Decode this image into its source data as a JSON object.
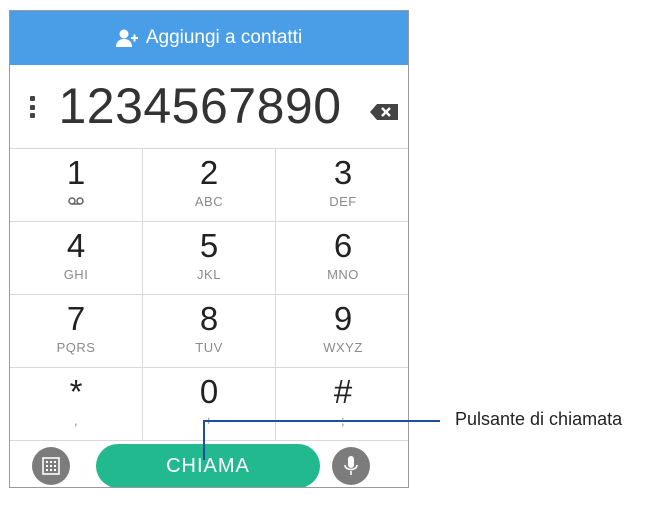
{
  "header": {
    "add_contact_label": "Aggiungi a contatti",
    "add_contact_icon": "add-contact-icon"
  },
  "display": {
    "number": "1234567890",
    "menu_icon": "overflow-menu-icon",
    "backspace_icon": "backspace-icon"
  },
  "keypad": {
    "keys": [
      {
        "digit": "1",
        "sub": ""
      },
      {
        "digit": "2",
        "sub": "ABC"
      },
      {
        "digit": "3",
        "sub": "DEF"
      },
      {
        "digit": "4",
        "sub": "GHI"
      },
      {
        "digit": "5",
        "sub": "JKL"
      },
      {
        "digit": "6",
        "sub": "MNO"
      },
      {
        "digit": "7",
        "sub": "PQRS"
      },
      {
        "digit": "8",
        "sub": "TUV"
      },
      {
        "digit": "9",
        "sub": "WXYZ"
      },
      {
        "digit": "*",
        "sub": ","
      },
      {
        "digit": "0",
        "sub": "+"
      },
      {
        "digit": "#",
        "sub": ";"
      }
    ],
    "voicemail_icon": "voicemail-icon"
  },
  "bottom": {
    "call_label": "CHIAMA",
    "dialpad_icon": "dialpad-icon",
    "mic_icon": "microphone-icon"
  },
  "annotation": {
    "label": "Pulsante di chiamata"
  },
  "colors": {
    "header_blue": "#4a9ee8",
    "call_green": "#22b98e",
    "callout_line": "#1f4e9a"
  }
}
